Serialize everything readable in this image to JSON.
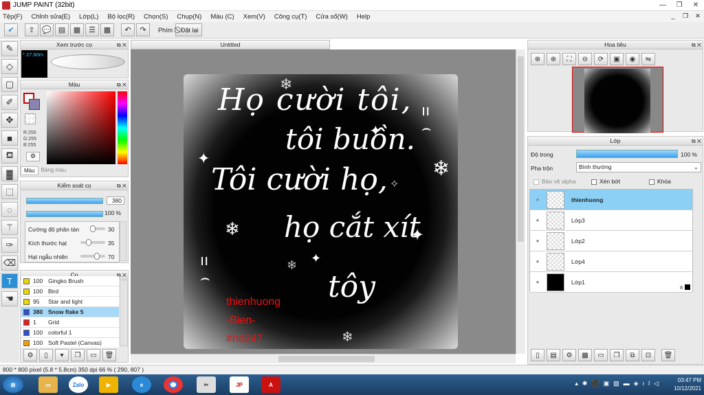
{
  "window": {
    "title": "JUMP PAINT (32bit)"
  },
  "menu": [
    "Tệp(F)",
    "Chỉnh sửa(E)",
    "Lớp(L)",
    "Bộ lọc(R)",
    "Chọn(S)",
    "Chụp(N)",
    "Màu (C)",
    "Xem(V)",
    "Công cụ(T)",
    "Cửa sổ(W)",
    "Help"
  ],
  "toolbar": {
    "label_phim": "Phím",
    "clear_label": "Đặt lại"
  },
  "preview": {
    "title": "Xem trước cọ",
    "size": "27.60m"
  },
  "color": {
    "title": "Màu",
    "r": "R:255",
    "g": "G:255",
    "b": "B:255",
    "tab1": "Màu",
    "tab2": "Bảng màu"
  },
  "brushctl": {
    "title": "Kiểm soát cọ",
    "size": "380",
    "opacity": "100 %",
    "density_label": "Cường độ phân tán",
    "density": "30",
    "particle_label": "Kích thước hạt",
    "particle": "35",
    "random_label": "Hạt ngẫu nhiên",
    "random": "70"
  },
  "brushes": {
    "title": "Cọ",
    "items": [
      {
        "size": "100",
        "name": "Gingko Brush",
        "color": "#e8d800"
      },
      {
        "size": "100",
        "name": "Bird",
        "color": "#e8d800"
      },
      {
        "size": "95",
        "name": "Star and light",
        "color": "#e8d800"
      },
      {
        "size": "380",
        "name": "Snow flake 5",
        "color": "#3050c8",
        "selected": true
      },
      {
        "size": "1",
        "name": "Grid",
        "color": "#e02020"
      },
      {
        "size": "100",
        "name": "colorful 1",
        "color": "#3050c8"
      },
      {
        "size": "100",
        "name": "Soft Pastel (Canvas)",
        "color": "#f0a000"
      }
    ]
  },
  "document": {
    "tab": "Untitled",
    "lines": [
      "Họ cười tôi,",
      "tôi buồn.",
      "Tôi cười họ,",
      "họ cắt xít",
      "tôy"
    ],
    "signature": [
      "thienhuong",
      "-Bien-",
      "#hd247"
    ]
  },
  "navigator": {
    "title": "Hoa tiêu"
  },
  "layers": {
    "title": "Lớp",
    "opacity_label": "Độ trong",
    "opacity": "100 %",
    "blend_label": "Pha trộn",
    "blend": "Bình thường",
    "protect_alpha": "Bảo vệ alpha",
    "clip": "Xén bớt",
    "lock": "Khóa",
    "items": [
      {
        "name": "thienhuong",
        "selected": true
      },
      {
        "name": "Lớp3"
      },
      {
        "name": "Lớp2"
      },
      {
        "name": "Lớp4"
      },
      {
        "name": "Lớp1",
        "black": true,
        "badge": "8"
      }
    ]
  },
  "status": {
    "text": "800 * 800 pixel   (5.8 * 5.8cm)   350 dpi   66 %   ( 290, 807 )"
  },
  "taskbar": {
    "time": "03:47 PM",
    "date": "10/12/2021",
    "zalo": "Zalo"
  }
}
